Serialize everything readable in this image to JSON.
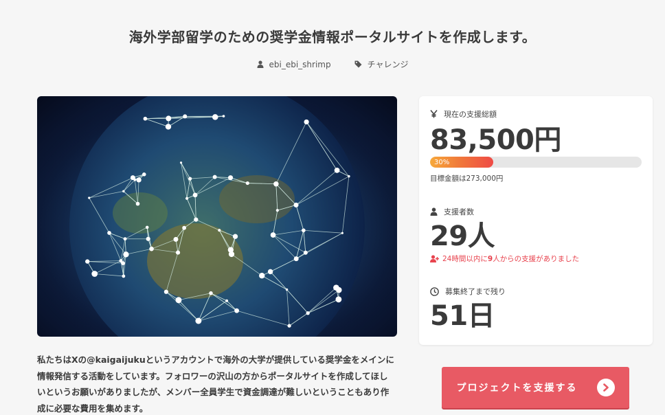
{
  "project": {
    "title": "海外学部留学のための奨学金情報ポータルサイトを作成します。",
    "author": "ebi_ebi_shrimp",
    "category": "チャレンジ"
  },
  "description": [
    "私たちはXの@kaigaijukuというアカウントで海外の大学が提供している奨学金をメインに",
    "情報発信する活動をしています。フォロワーの沢山の方からポータルサイトを作成してほし",
    "いというお願いがありましたが、メンバー全員学生で資金調達が難しいということもあり作",
    "成に必要な費用を集めます。"
  ],
  "stats": {
    "funding_label": "現在の支援総額",
    "funding_amount": "83,500円",
    "progress_percent": 30,
    "progress_text": "30%",
    "goal_text": "目標金額は273,000円",
    "backers_label": "支援者数",
    "backers_count": "29人",
    "recent_prefix": "24時間以内に",
    "recent_number": "9",
    "recent_suffix": "人からの支援がありました",
    "remaining_label": "募集終了まで残り",
    "remaining_days": "51日"
  },
  "cta": {
    "support_label": "プロジェクトを支援する"
  },
  "colors": {
    "accent": "#e85a64",
    "alert": "#e8434e",
    "progress_start": "#f7a93b",
    "progress_end": "#ef4b46"
  },
  "icons": {
    "author": "user-icon",
    "category": "tag-icon",
    "funding": "yen-icon",
    "backers": "user-icon",
    "recent": "user-plus-icon",
    "remaining": "clock-icon",
    "cta": "chevron-right-circle-icon"
  }
}
